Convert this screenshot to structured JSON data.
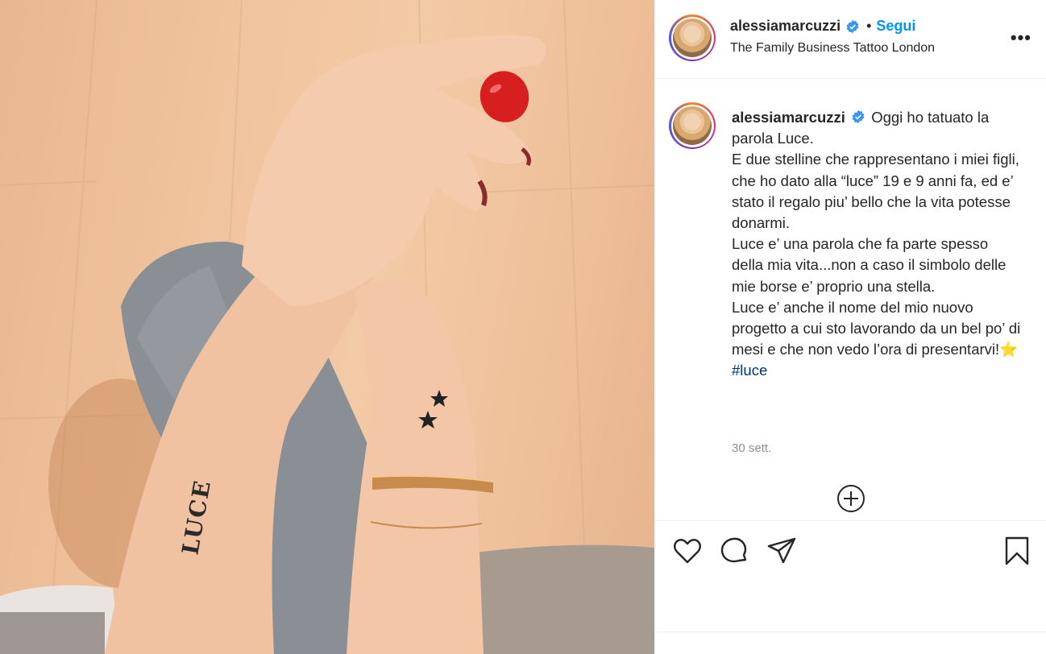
{
  "post": {
    "username": "alessiamarcuzzi",
    "follow_label": "Segui",
    "separator": "•",
    "location": "The Family Business Tattoo London",
    "more_label": "•••"
  },
  "caption": {
    "username": "alessiamarcuzzi",
    "lines": [
      "Oggi ho tatuato la parola Luce.",
      "E due stelline che rappresentano i miei figli, che ho dato alla “luce” 19 e 9 anni fa, ed e’ stato il regalo piu’ bello che la vita potesse donarmi.",
      "Luce e’ una parola che fa parte spesso della mia vita...non a caso il simbolo delle mie borse e’ proprio una stella.",
      "Luce e’ anche il nome del mio nuovo progetto a cui sto lavorando da un bel po’ di mesi e che non vedo l’ora di presentarvi!⭐"
    ],
    "hashtag": "#luce",
    "time": "30 sett."
  },
  "photo": {
    "tattoo_text": "LUCE"
  },
  "icons": {
    "like": "heart-icon",
    "comment": "comment-icon",
    "share": "share-icon",
    "save": "bookmark-icon",
    "add": "plus-circle-icon",
    "verified": "verified-badge-icon"
  },
  "colors": {
    "follow": "#0095f6",
    "hashtag": "#00376b",
    "verified": "#3897f0",
    "muted": "#8e8e8e",
    "nail": "#d81f1f"
  }
}
